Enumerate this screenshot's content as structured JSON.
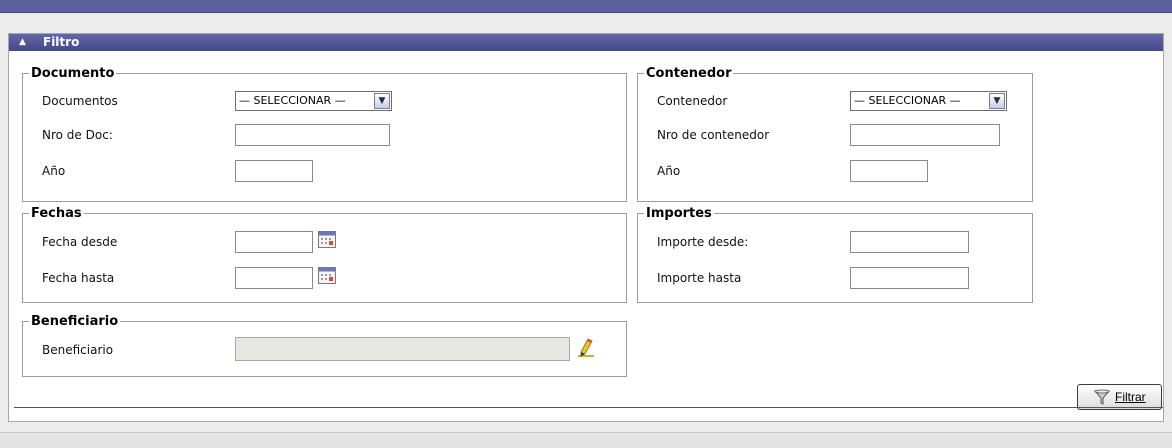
{
  "panel": {
    "title": "Filtro"
  },
  "documento": {
    "legend": "Documento",
    "documentos_label": "Documentos",
    "documentos_value": "— SELECCIONAR —",
    "nro_doc_label": "Nro de Doc:",
    "nro_doc_value": "",
    "anio_label": "Año",
    "anio_value": ""
  },
  "contenedor": {
    "legend": "Contenedor",
    "contenedor_label": "Contenedor",
    "contenedor_value": "— SELECCIONAR —",
    "nro_contenedor_label": "Nro de contenedor",
    "nro_contenedor_value": "",
    "anio_label": "Año",
    "anio_value": ""
  },
  "fechas": {
    "legend": "Fechas",
    "desde_label": "Fecha desde",
    "desde_value": "",
    "hasta_label": "Fecha hasta",
    "hasta_value": ""
  },
  "importes": {
    "legend": "Importes",
    "desde_label": "Importe desde:",
    "desde_value": "",
    "hasta_label": "Importe hasta",
    "hasta_value": ""
  },
  "beneficiario": {
    "legend": "Beneficiario",
    "label": "Beneficiario",
    "value": ""
  },
  "actions": {
    "filter_label": "Filtrar"
  },
  "icons": {
    "collapse": "triangle-up-icon",
    "calendar": "calendar-icon",
    "edit": "pencil-icon",
    "filter": "funnel-icon",
    "dropdown": "chevron-down-icon"
  },
  "colors": {
    "header": "#4f5396",
    "top_bar": "#5b5f9c",
    "page_bg": "#ececec"
  }
}
